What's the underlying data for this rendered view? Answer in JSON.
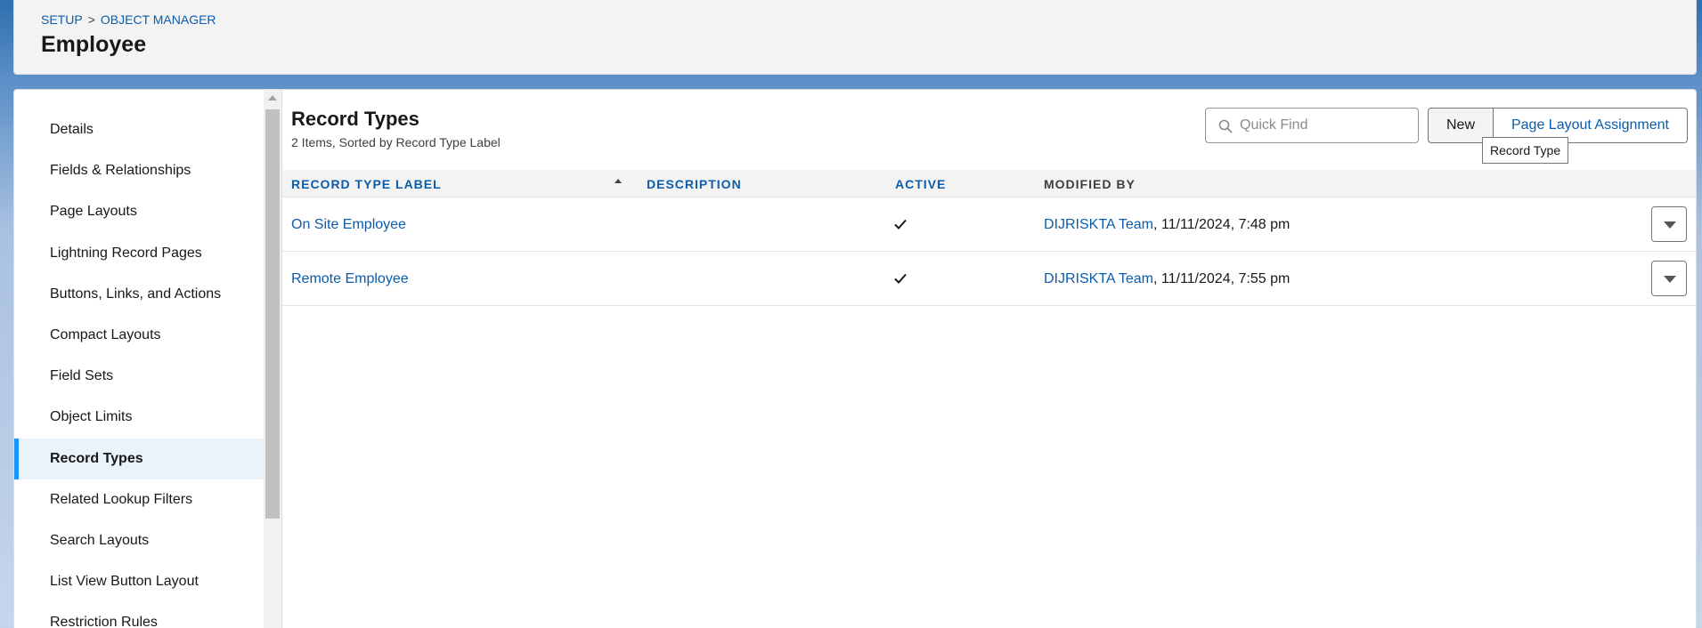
{
  "breadcrumb": {
    "setup": "SETUP",
    "separator": ">",
    "object_manager": "OBJECT MANAGER"
  },
  "page_title": "Employee",
  "sidebar": {
    "items": [
      {
        "label": "Details"
      },
      {
        "label": "Fields & Relationships"
      },
      {
        "label": "Page Layouts"
      },
      {
        "label": "Lightning Record Pages"
      },
      {
        "label": "Buttons, Links, and Actions"
      },
      {
        "label": "Compact Layouts"
      },
      {
        "label": "Field Sets"
      },
      {
        "label": "Object Limits"
      },
      {
        "label": "Record Types",
        "active": true
      },
      {
        "label": "Related Lookup Filters"
      },
      {
        "label": "Search Layouts"
      },
      {
        "label": "List View Button Layout"
      },
      {
        "label": "Restriction Rules"
      }
    ]
  },
  "section": {
    "title": "Record Types",
    "subtitle": "2 Items, Sorted by Record Type Label"
  },
  "quick_find": {
    "placeholder": "Quick Find",
    "icon": "search-icon"
  },
  "buttons": {
    "new": "New",
    "page_layout_assignment": "Page Layout Assignment"
  },
  "tooltip": "Record Type",
  "table": {
    "columns": {
      "record_type_label": "RECORD TYPE LABEL",
      "description": "DESCRIPTION",
      "active": "ACTIVE",
      "modified_by": "MODIFIED BY"
    },
    "sort": {
      "column": "record_type_label",
      "direction": "ascending"
    },
    "rows": [
      {
        "label": "On Site Employee",
        "description": "",
        "active": true,
        "modified_by_user": "DIJRISKTA Team",
        "modified_date": ", 11/11/2024, 7:48 pm"
      },
      {
        "label": "Remote Employee",
        "description": "",
        "active": true,
        "modified_by_user": "DIJRISKTA Team",
        "modified_date": ", 11/11/2024, 7:55 pm"
      }
    ]
  },
  "colors": {
    "link": "#0b5cab",
    "active_nav_accent": "#1b96ff",
    "active_nav_bg": "#eaf2fb"
  }
}
